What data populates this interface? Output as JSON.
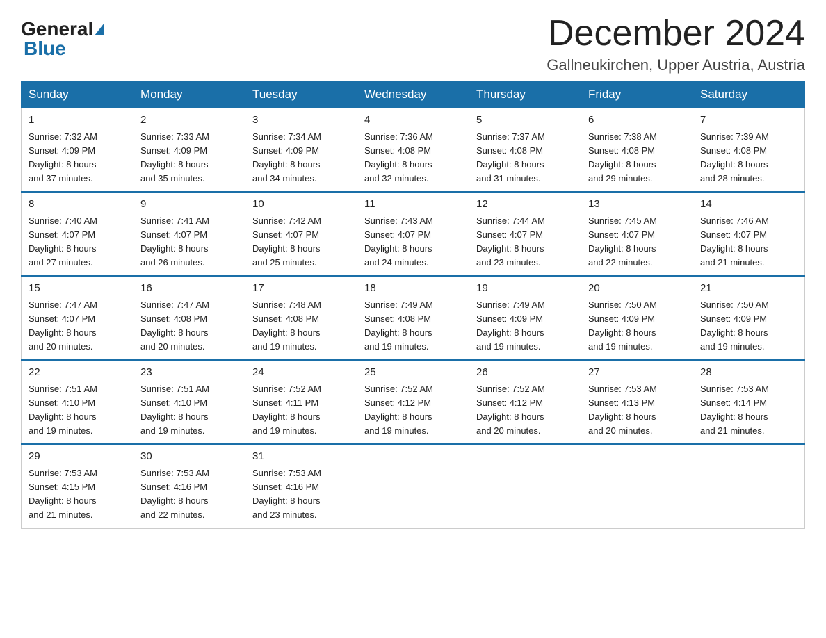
{
  "logo": {
    "general": "General",
    "blue": "Blue"
  },
  "title": "December 2024",
  "location": "Gallneukirchen, Upper Austria, Austria",
  "headers": [
    "Sunday",
    "Monday",
    "Tuesday",
    "Wednesday",
    "Thursday",
    "Friday",
    "Saturday"
  ],
  "weeks": [
    [
      {
        "day": "1",
        "sunrise": "7:32 AM",
        "sunset": "4:09 PM",
        "daylight": "8 hours and 37 minutes."
      },
      {
        "day": "2",
        "sunrise": "7:33 AM",
        "sunset": "4:09 PM",
        "daylight": "8 hours and 35 minutes."
      },
      {
        "day": "3",
        "sunrise": "7:34 AM",
        "sunset": "4:09 PM",
        "daylight": "8 hours and 34 minutes."
      },
      {
        "day": "4",
        "sunrise": "7:36 AM",
        "sunset": "4:08 PM",
        "daylight": "8 hours and 32 minutes."
      },
      {
        "day": "5",
        "sunrise": "7:37 AM",
        "sunset": "4:08 PM",
        "daylight": "8 hours and 31 minutes."
      },
      {
        "day": "6",
        "sunrise": "7:38 AM",
        "sunset": "4:08 PM",
        "daylight": "8 hours and 29 minutes."
      },
      {
        "day": "7",
        "sunrise": "7:39 AM",
        "sunset": "4:08 PM",
        "daylight": "8 hours and 28 minutes."
      }
    ],
    [
      {
        "day": "8",
        "sunrise": "7:40 AM",
        "sunset": "4:07 PM",
        "daylight": "8 hours and 27 minutes."
      },
      {
        "day": "9",
        "sunrise": "7:41 AM",
        "sunset": "4:07 PM",
        "daylight": "8 hours and 26 minutes."
      },
      {
        "day": "10",
        "sunrise": "7:42 AM",
        "sunset": "4:07 PM",
        "daylight": "8 hours and 25 minutes."
      },
      {
        "day": "11",
        "sunrise": "7:43 AM",
        "sunset": "4:07 PM",
        "daylight": "8 hours and 24 minutes."
      },
      {
        "day": "12",
        "sunrise": "7:44 AM",
        "sunset": "4:07 PM",
        "daylight": "8 hours and 23 minutes."
      },
      {
        "day": "13",
        "sunrise": "7:45 AM",
        "sunset": "4:07 PM",
        "daylight": "8 hours and 22 minutes."
      },
      {
        "day": "14",
        "sunrise": "7:46 AM",
        "sunset": "4:07 PM",
        "daylight": "8 hours and 21 minutes."
      }
    ],
    [
      {
        "day": "15",
        "sunrise": "7:47 AM",
        "sunset": "4:07 PM",
        "daylight": "8 hours and 20 minutes."
      },
      {
        "day": "16",
        "sunrise": "7:47 AM",
        "sunset": "4:08 PM",
        "daylight": "8 hours and 20 minutes."
      },
      {
        "day": "17",
        "sunrise": "7:48 AM",
        "sunset": "4:08 PM",
        "daylight": "8 hours and 19 minutes."
      },
      {
        "day": "18",
        "sunrise": "7:49 AM",
        "sunset": "4:08 PM",
        "daylight": "8 hours and 19 minutes."
      },
      {
        "day": "19",
        "sunrise": "7:49 AM",
        "sunset": "4:09 PM",
        "daylight": "8 hours and 19 minutes."
      },
      {
        "day": "20",
        "sunrise": "7:50 AM",
        "sunset": "4:09 PM",
        "daylight": "8 hours and 19 minutes."
      },
      {
        "day": "21",
        "sunrise": "7:50 AM",
        "sunset": "4:09 PM",
        "daylight": "8 hours and 19 minutes."
      }
    ],
    [
      {
        "day": "22",
        "sunrise": "7:51 AM",
        "sunset": "4:10 PM",
        "daylight": "8 hours and 19 minutes."
      },
      {
        "day": "23",
        "sunrise": "7:51 AM",
        "sunset": "4:10 PM",
        "daylight": "8 hours and 19 minutes."
      },
      {
        "day": "24",
        "sunrise": "7:52 AM",
        "sunset": "4:11 PM",
        "daylight": "8 hours and 19 minutes."
      },
      {
        "day": "25",
        "sunrise": "7:52 AM",
        "sunset": "4:12 PM",
        "daylight": "8 hours and 19 minutes."
      },
      {
        "day": "26",
        "sunrise": "7:52 AM",
        "sunset": "4:12 PM",
        "daylight": "8 hours and 20 minutes."
      },
      {
        "day": "27",
        "sunrise": "7:53 AM",
        "sunset": "4:13 PM",
        "daylight": "8 hours and 20 minutes."
      },
      {
        "day": "28",
        "sunrise": "7:53 AM",
        "sunset": "4:14 PM",
        "daylight": "8 hours and 21 minutes."
      }
    ],
    [
      {
        "day": "29",
        "sunrise": "7:53 AM",
        "sunset": "4:15 PM",
        "daylight": "8 hours and 21 minutes."
      },
      {
        "day": "30",
        "sunrise": "7:53 AM",
        "sunset": "4:16 PM",
        "daylight": "8 hours and 22 minutes."
      },
      {
        "day": "31",
        "sunrise": "7:53 AM",
        "sunset": "4:16 PM",
        "daylight": "8 hours and 23 minutes."
      },
      null,
      null,
      null,
      null
    ]
  ],
  "labels": {
    "sunrise": "Sunrise:",
    "sunset": "Sunset:",
    "daylight": "Daylight:"
  }
}
